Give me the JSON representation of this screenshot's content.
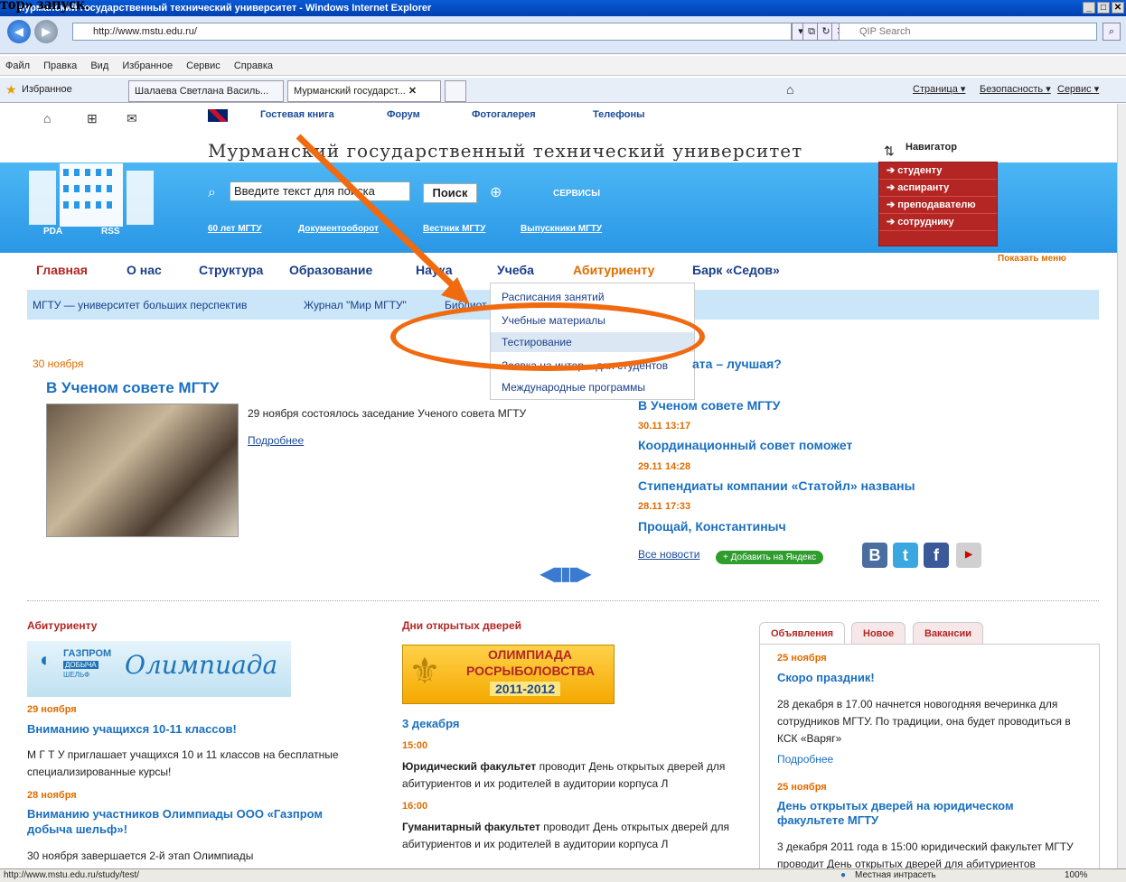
{
  "doc_fragment": "тор» запуск.",
  "window": {
    "title": "Мурманский государственный технический университет - Windows Internet Explorer",
    "controls": [
      "_",
      "□",
      "✕"
    ]
  },
  "address": {
    "url": "http://www.mstu.edu.ru/",
    "search_placeholder": "QIP Search"
  },
  "menu": [
    "Файл",
    "Правка",
    "Вид",
    "Избранное",
    "Сервис",
    "Справка"
  ],
  "favbar": {
    "favorites": "Избранное",
    "tabs": [
      "Шалаева Светлана Василь...",
      "Мурманский государст..."
    ],
    "right_items": [
      "Страница ▾",
      "Безопасность ▾",
      "Сервис ▾"
    ]
  },
  "site": {
    "top_links": [
      "Гостевая книга",
      "Форум",
      "Фотогалерея",
      "Телефоны"
    ],
    "title": "Мурманский государственный технический университет",
    "navigator": "Навигатор",
    "search_placeholder": "Введите текст для поиска",
    "search_button": "Поиск",
    "services": "СЕРВИСЫ",
    "pda": "PDA",
    "rss": "RSS",
    "bottom_links": [
      "60 лет МГТУ",
      "Документооборот",
      "Вестник МГТУ",
      "Выпускники МГТУ"
    ],
    "red_menu": [
      "студенту",
      "аспиранту",
      "преподавателю",
      "сотруднику"
    ],
    "show_menu": "Показать меню"
  },
  "nav": {
    "items": [
      "Главная",
      "О нас",
      "Структура",
      "Образование",
      "Наука",
      "Учеба",
      "Абитуриенту",
      "Барк «Седов»"
    ],
    "sub": [
      "МГТУ — университет больших перспектив",
      "Журнал \"Мир МГТУ\"",
      "Библиот"
    ]
  },
  "dropdown": [
    "Расписания занятий",
    "Учебные материалы",
    "Тестирование",
    "Заявка на интер... для студентов",
    "Международные программы"
  ],
  "feature": {
    "date": "30 ноября",
    "title": "В Ученом совете МГТУ",
    "text": "29 ноября состоялось заседание Ученого совета МГТУ",
    "more": "Подробнее"
  },
  "news": {
    "partial_title": "ата – лучшая?",
    "items": [
      {
        "date": "",
        "title": "В Ученом совете МГТУ"
      },
      {
        "date": "30.11 13:17",
        "title": "Координационный совет поможет"
      },
      {
        "date": "29.11 14:28",
        "title": "Стипендиаты компании «Статойл» названы"
      },
      {
        "date": "28.11 17:33",
        "title": "Прощай, Константиныч"
      }
    ],
    "all": "Все новости",
    "yandex": "+ Добавить на Яндекс"
  },
  "abitur": {
    "heading": "Абитуриенту",
    "banner": "Олимпиада",
    "banner_brand": "ГАЗПРОМ",
    "banner_sub": "ДОБЫЧА",
    "banner_sub2": "ШЕЛЬФ",
    "d1": "29 ноября",
    "t1": "Вниманию учащихся 10-11 классов!",
    "p1": "М Г Т У приглашает учащихся 10 и 11 классов на бесплатные специализированные курсы!",
    "d2": "28 ноября",
    "t2": "Вниманию участников Олимпиады ООО «Газпром добыча шельф»!",
    "p2": "30 ноября завершается 2-й этап Олимпиады"
  },
  "open_days": {
    "heading": "Дни открытых дверей",
    "banner1": "ОЛИМПИАДА",
    "banner2": "РОСРЫБОЛОВСТВА",
    "banner3": "2011-2012",
    "date": "3 декабря",
    "time1": "15:00",
    "bold1": "Юридический факультет",
    "text1": " проводит День открытых дверей для абитуриентов и их родителей в аудитории корпуса Л",
    "time2": "16:00",
    "bold2": "Гуманитарный факультет",
    "text2": " проводит День открытых дверей для абитуриентов и их родителей в аудитории корпуса Л"
  },
  "right_tabs": {
    "tabs": [
      "Объявления",
      "Новое",
      "Вакансии"
    ],
    "d1": "25 ноября",
    "t1": "Скоро праздник!",
    "p1": "28 декабря в 17.00 начнется новогодняя вечеринка для сотрудников МГТУ. По традиции, она будет проводиться в КСК «Варяг»",
    "more": "Подробнее",
    "d2": "25 ноября",
    "t2": "День открытых дверей на юридическом факультете МГТУ",
    "p2": "3 декабря 2011 года в 15:00 юридический факультет МГТУ проводит День открытых дверей для абитуриентов"
  },
  "status": {
    "url": "http://www.mstu.edu.ru/study/test/",
    "zone": "Местная интрасеть",
    "zoom": "100%"
  }
}
